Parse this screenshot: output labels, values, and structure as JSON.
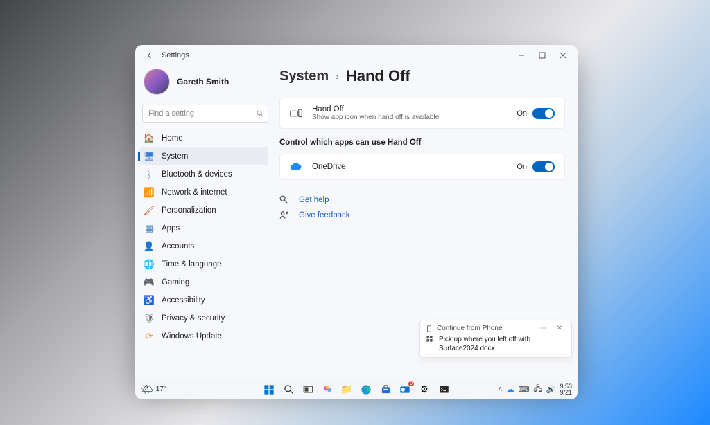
{
  "window": {
    "title": "Settings",
    "user": "Gareth Smith",
    "search_placeholder": "Find a setting"
  },
  "nav": [
    {
      "label": "Home",
      "icon": "🏠"
    },
    {
      "label": "System",
      "icon": "🖥"
    },
    {
      "label": "Bluetooth & devices",
      "icon": "ᛒ"
    },
    {
      "label": "Network & internet",
      "icon": "📶"
    },
    {
      "label": "Personalization",
      "icon": "🖌"
    },
    {
      "label": "Apps",
      "icon": "▦"
    },
    {
      "label": "Accounts",
      "icon": "👤"
    },
    {
      "label": "Time & language",
      "icon": "🌐"
    },
    {
      "label": "Gaming",
      "icon": "🎮"
    },
    {
      "label": "Accessibility",
      "icon": "♿"
    },
    {
      "label": "Privacy & security",
      "icon": "🛡"
    },
    {
      "label": "Windows Update",
      "icon": "⟳"
    }
  ],
  "breadcrumb": {
    "section": "System",
    "page": "Hand Off"
  },
  "handoff_card": {
    "title": "Hand Off",
    "subtitle": "Show app icon when hand off is available",
    "state": "On"
  },
  "apps_section_title": "Control which apps can use Hand Off",
  "app_card": {
    "name": "OneDrive",
    "state": "On"
  },
  "links": {
    "help": "Get help",
    "feedback": "Give feedback"
  },
  "notification": {
    "title": "Continue from Phone",
    "message": "Pick up where you left off with Surface2024.docx"
  },
  "taskbar": {
    "weather_temp": "17°",
    "time": "9:53",
    "date": "9/21"
  }
}
